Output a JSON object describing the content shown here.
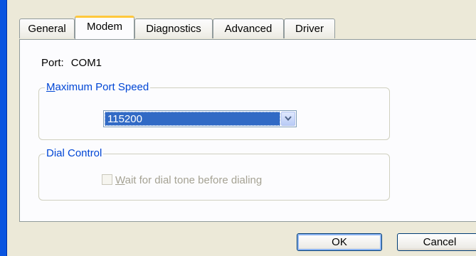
{
  "tabs": [
    {
      "label": "General"
    },
    {
      "label": "Modem"
    },
    {
      "label": "Diagnostics"
    },
    {
      "label": "Advanced"
    },
    {
      "label": "Driver"
    }
  ],
  "active_tab": "Modem",
  "port": {
    "label": "Port:",
    "value": "COM1"
  },
  "max_speed": {
    "legend_accel": "M",
    "legend_rest": "aximum Port Speed",
    "selected": "115200"
  },
  "dial_control": {
    "legend": "Dial Control",
    "checkbox_accel": "W",
    "checkbox_rest": "ait for dial tone before dialing",
    "checked": false,
    "enabled": false
  },
  "buttons": {
    "ok": "OK",
    "cancel": "Cancel"
  },
  "colors": {
    "accent": "#0046d5",
    "selection": "#316ac5",
    "tab_highlight": "#ffc83c"
  }
}
